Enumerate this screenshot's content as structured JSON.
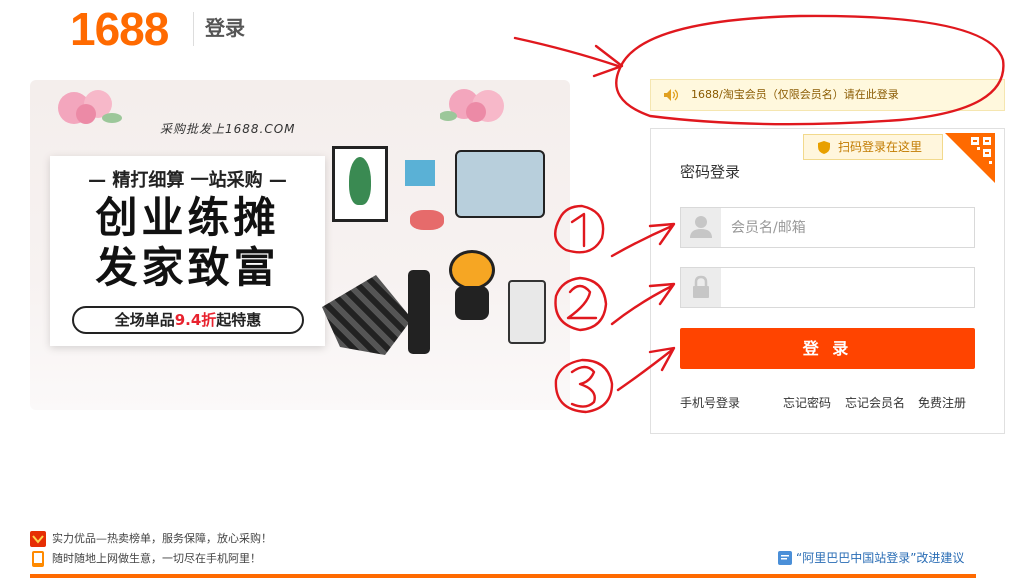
{
  "header": {
    "logo": "1688",
    "title": "登录"
  },
  "banner": {
    "slogan_small": "采购批发上1688.COM",
    "line1": "— 精打细算  一站采购 —",
    "big1": "创业练摊",
    "big2": "发家致富",
    "pill_prefix": "全场单品",
    "pill_highlight": "9.4折",
    "pill_suffix": "起特惠"
  },
  "notice": {
    "text": "1688/淘宝会员（仅限会员名）请在此登录"
  },
  "login": {
    "qr_tip": "扫码登录在这里",
    "title": "密码登录",
    "username_placeholder": "会员名/邮箱",
    "password_placeholder": "",
    "submit_label": "登 录",
    "links": {
      "phone_login": "手机号登录",
      "forgot_password": "忘记密码",
      "forgot_username": "忘记会员名",
      "register": "免费注册"
    }
  },
  "footer": {
    "line1": "实力优品—热卖榜单，服务保障，放心采购！",
    "line2": "随时随地上网做生意，一切尽在手机阿里！",
    "feedback": "“阿里巴巴中国站登录”改进建议"
  },
  "colors": {
    "brand_orange": "#ff6a00",
    "button_orange": "#ff4400",
    "annotation_red": "#e0181e"
  }
}
